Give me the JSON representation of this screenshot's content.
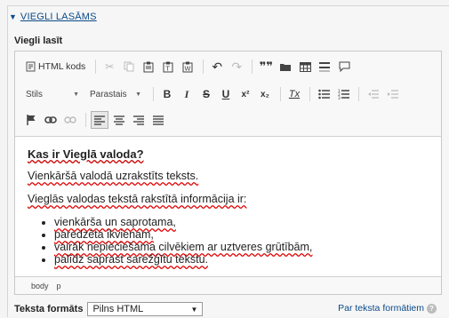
{
  "section": {
    "title": "VIEGLI LASĀMS"
  },
  "field": {
    "label": "Viegli lasīt"
  },
  "toolbar": {
    "source_label": "HTML kods",
    "styles_label": "Stils",
    "format_label": "Parastais",
    "bold_label": "B",
    "italic_label": "I",
    "strike_label": "S",
    "underline_label": "U",
    "superscript_label": "x²",
    "subscript_label": "x₂",
    "removeformat_label": "Tx",
    "blockquote_label": "99"
  },
  "content": {
    "heading": "Kas ir Vieglā valoda?",
    "para1": "Vienkāršā valodā uzrakstīts teksts.",
    "para2": "Vieglās valodas tekstā rakstītā informācija ir:",
    "list": [
      "vienkārša un saprotama,",
      "paredzēta ikvienam,",
      "vairāk nepieciešama cilvēkiem ar uztveres grūtībām,",
      "palīdz saprast sarežģītu tekstu."
    ]
  },
  "path": {
    "items": [
      "body",
      "p"
    ]
  },
  "format": {
    "label": "Teksta formāts",
    "selected": "Pilns HTML",
    "help_link": "Par teksta formātiem",
    "help_icon": "?"
  }
}
